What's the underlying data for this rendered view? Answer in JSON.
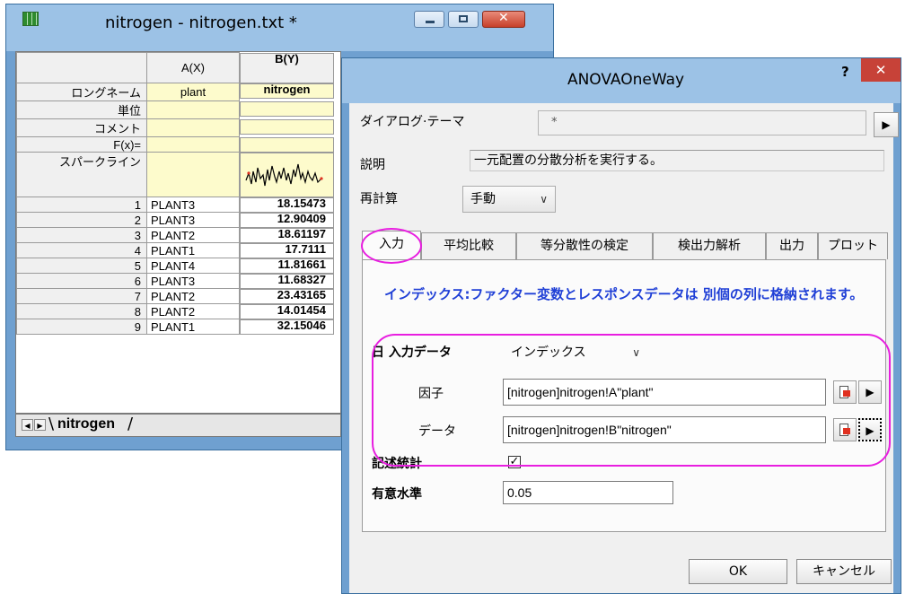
{
  "worksheet": {
    "title": "nitrogen - nitrogen.txt *",
    "columns": [
      "A(X)",
      "B(Y)"
    ],
    "meta_rows": [
      {
        "label": "ロングネーム",
        "a": "plant",
        "b": "nitrogen"
      },
      {
        "label": "単位",
        "a": "",
        "b": ""
      },
      {
        "label": "コメント",
        "a": "",
        "b": ""
      },
      {
        "label": "F(x)=",
        "a": "",
        "b": ""
      },
      {
        "label": "スパークライン",
        "a": "",
        "b": ""
      }
    ],
    "rows": [
      {
        "n": "1",
        "a": "PLANT3",
        "b": "18.15473"
      },
      {
        "n": "2",
        "a": "PLANT3",
        "b": "12.90409"
      },
      {
        "n": "3",
        "a": "PLANT2",
        "b": "18.61197"
      },
      {
        "n": "4",
        "a": "PLANT1",
        "b": "17.7111"
      },
      {
        "n": "5",
        "a": "PLANT4",
        "b": "11.81661"
      },
      {
        "n": "6",
        "a": "PLANT3",
        "b": "11.68327"
      },
      {
        "n": "7",
        "a": "PLANT2",
        "b": "23.43165"
      },
      {
        "n": "8",
        "a": "PLANT2",
        "b": "14.01454"
      },
      {
        "n": "9",
        "a": "PLANT1",
        "b": "32.15046"
      }
    ],
    "sheet_tab": "nitrogen"
  },
  "dialog": {
    "title": "ANOVAOneWay",
    "help": "?",
    "close": "✕",
    "theme_label": "ダイアログ·テーマ",
    "theme_value": "*",
    "desc_label": "説明",
    "desc_value": "一元配置の分散分析を実行する。",
    "recalc_label": "再計算",
    "recalc_value": "手動",
    "tabs": [
      "入力",
      "平均比較",
      "等分散性の検定",
      "検出力解析",
      "出力",
      "プロット"
    ],
    "notice": "インデックス:ファクター変数とレスポンスデータは 別個の列に格納されます。",
    "input_label": "入力データ",
    "input_toggle": "日",
    "input_value": "インデックス",
    "factor_label": "因子",
    "factor_value": "[nitrogen]nitrogen!A\"plant\"",
    "data_label": "データ",
    "data_value": "[nitrogen]nitrogen!B\"nitrogen\"",
    "stats_label": "記述統計",
    "stats_checked": "✓",
    "sig_label": "有意水準",
    "sig_value": "0.05",
    "ok": "OK",
    "cancel": "キャンセル"
  },
  "colors": {
    "highlight": "#e81ee0",
    "notice": "#1f3fd6",
    "meta_bg": "#fdfbcc"
  }
}
